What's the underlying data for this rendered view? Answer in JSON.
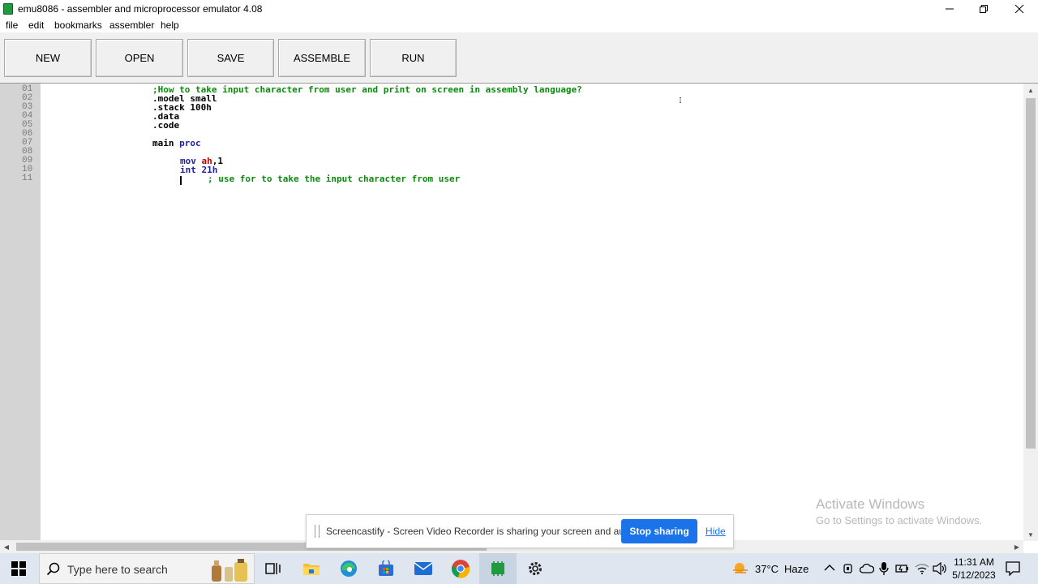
{
  "window": {
    "title": "emu8086 - assembler and microprocessor emulator 4.08",
    "controls": [
      "minimize",
      "restore",
      "close"
    ]
  },
  "menu": [
    "file",
    "edit",
    "bookmarks",
    "assembler",
    "help"
  ],
  "toolbar": {
    "new_label": "NEW",
    "open_label": "OPEN",
    "save_label": "SAVE",
    "assemble_label": "ASSEMBLE",
    "run_label": "RUN"
  },
  "editor": {
    "line_numbers": [
      "01",
      "02",
      "03",
      "04",
      "05",
      "06",
      "07",
      "08",
      "09",
      "10",
      "11"
    ],
    "lines": {
      "l01": ";How to take input character from user and print on screen in assembly language?",
      "l02": ".model small",
      "l03": ".stack 100h",
      "l04": ".data",
      "l05": ".code",
      "l07_main": "main ",
      "l07_proc": "proc",
      "l09_mov": "mov ",
      "l09_ah": "ah",
      "l09_rest": ",1",
      "l10": "int 21h",
      "l11_comment": "; use for to take the input character from user"
    },
    "colors": {
      "comment": "#0a8a0a",
      "keyword": "#1f1fa0",
      "register": "#c00000",
      "gutter": "#d4d4d4"
    }
  },
  "watermark": {
    "line1": "Activate Windows",
    "line2": "Go to Settings to activate Windows."
  },
  "share_bar": {
    "message": "Screencastify - Screen Video Recorder is sharing your screen and audio.",
    "stop_label": "Stop sharing",
    "hide_label": "Hide"
  },
  "taskbar": {
    "search_placeholder": "Type here to search",
    "apps": [
      "start-icon",
      "search-icon",
      "widgets-icon",
      "task-view-icon",
      "file-explorer-icon",
      "edge-icon",
      "store-icon",
      "mail-icon",
      "chrome-icon",
      "emu8086-icon",
      "settings-icon"
    ],
    "weather_temp": "37°C",
    "weather_desc": "Haze",
    "time": "11:31 AM",
    "date": "5/12/2023"
  }
}
